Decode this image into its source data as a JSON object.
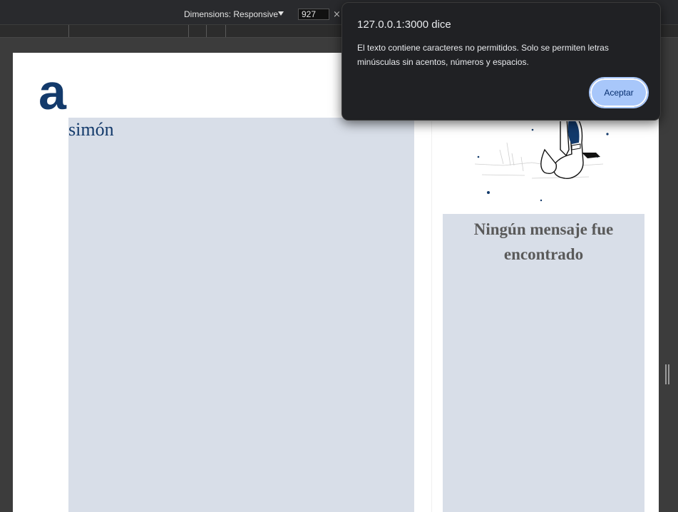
{
  "devtools": {
    "dimensions_label": "Dimensions: Responsive",
    "width_value": "927",
    "clear_glyph": "×"
  },
  "page": {
    "brand_logo_text": "a",
    "profile_name": "simón",
    "empty_messages_text": "Ningún mensaje fue encontrado"
  },
  "dialog": {
    "title": "127.0.0.1:3000 dice",
    "message": "El texto contiene caracteres no permitidos. Solo se permiten letras minúsculas sin acentos, números y espacios.",
    "accept_label": "Aceptar"
  },
  "colors": {
    "brand_navy": "#133a6b",
    "panel_gray_blue": "#d8dee8",
    "dialog_bg": "#202124",
    "button_blue": "#a8c7fa"
  },
  "icons": [
    "chevron-down-icon",
    "close-icon",
    "resize-handle-icon"
  ]
}
